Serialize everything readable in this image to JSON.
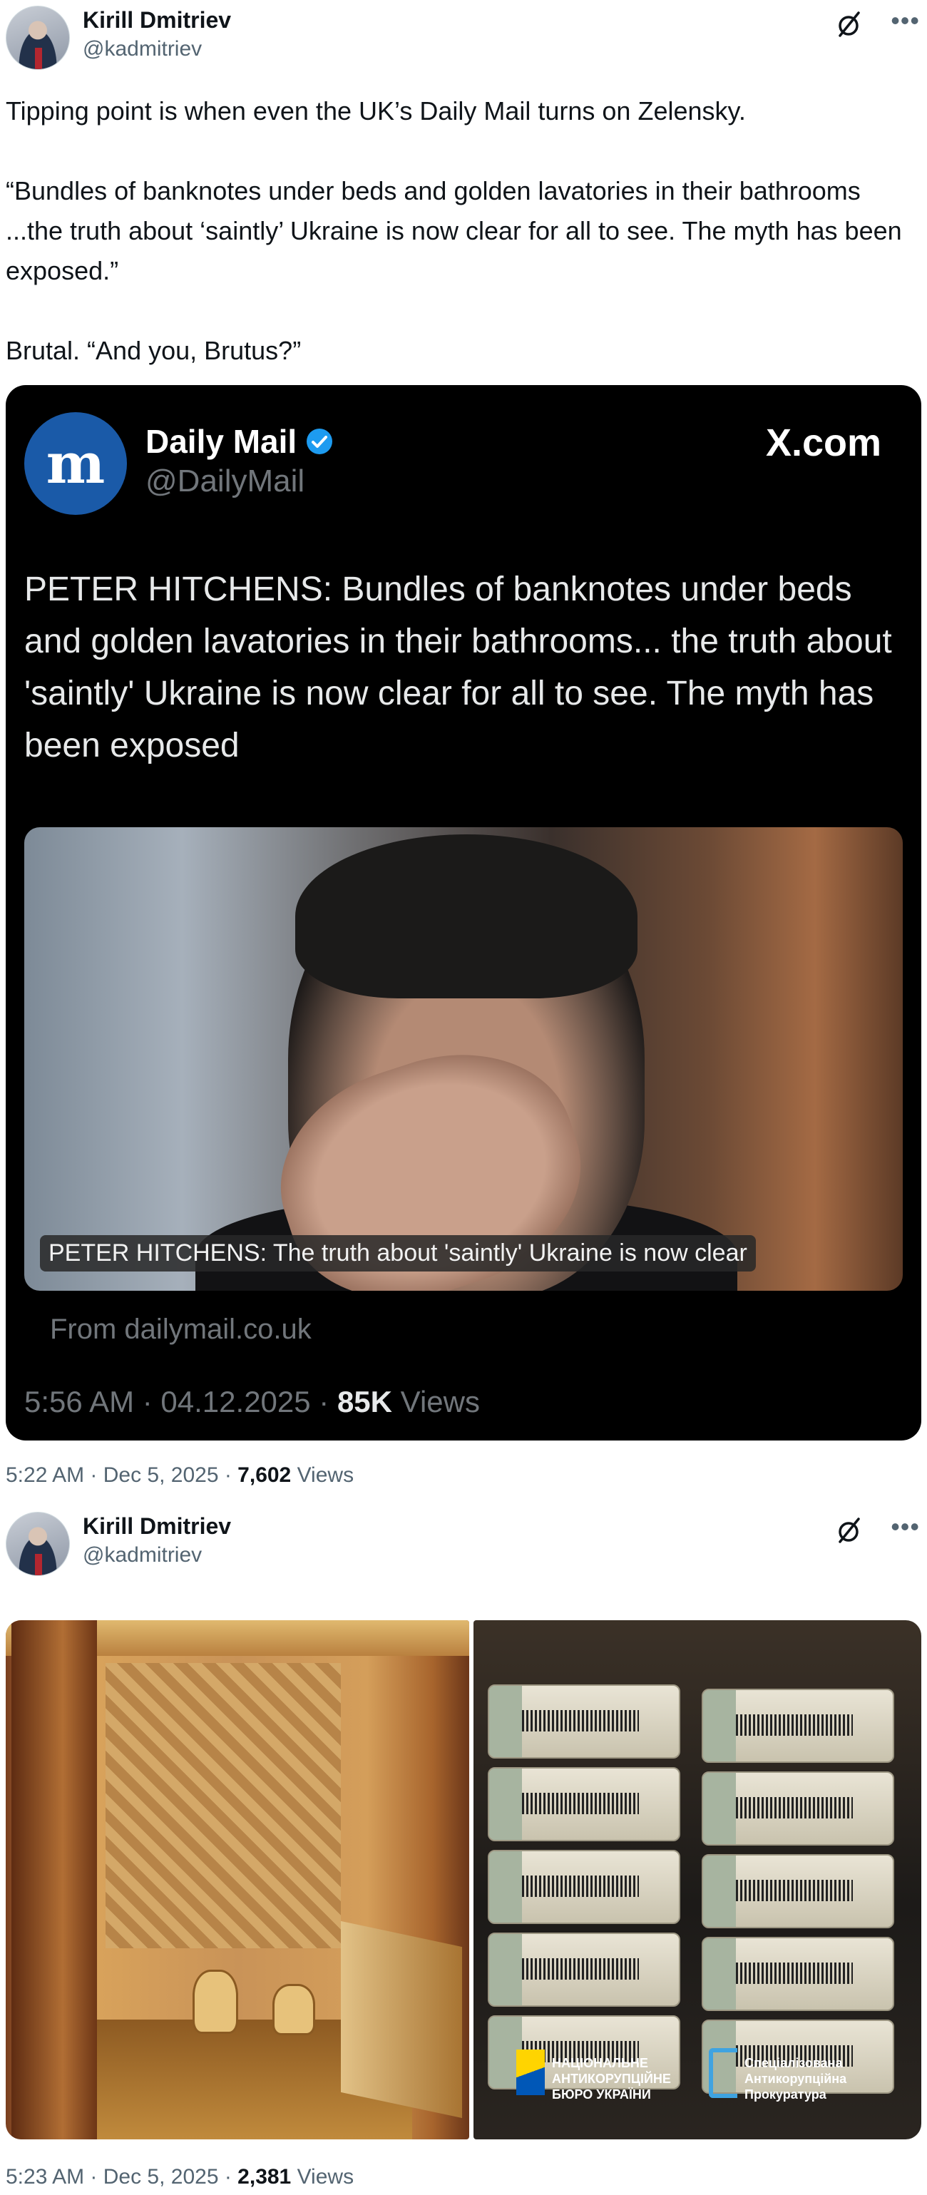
{
  "tweets": [
    {
      "author_name": "Kirill Dmitriev",
      "author_handle": "@kadmitriev",
      "text_paragraphs": [
        "Tipping point is when even the UK’s Daily Mail turns on Zelensky.",
        "“Bundles of banknotes under beds and golden lavatories in their bathrooms ...the truth about ‘saintly’ Ukraine is now clear for all to see. The myth has been exposed.”",
        "Brutal. “And you, Brutus?”"
      ],
      "quoted": {
        "logo_letter": "m",
        "name": "Daily Mail",
        "handle": "@DailyMail",
        "site": "X.com",
        "text": "PETER HITCHENS: Bundles of banknotes under beds and golden lavatories in their bathrooms... the truth about 'saintly' Ukraine is now clear for all to see. The myth has been exposed",
        "image_caption": "PETER HITCHENS: The truth about 'saintly' Ukraine is now clear",
        "source": "From dailymail.co.uk",
        "time": "5:56 AM · 04.12.2025 · ",
        "views_count": "85K",
        "views_label": " Views"
      },
      "time": "5:22 AM · Dec 5, 2025 · ",
      "views_count": "7,602",
      "views_label": " Views"
    },
    {
      "author_name": "Kirill Dmitriev",
      "author_handle": "@kadmitriev",
      "media_overlay": {
        "nabu_text": "НАЦІОНАЛЬНЕ АНТИКОРУПЦІЙНЕ БЮРО УКРАЇНИ",
        "sap_text": "Спеціалізована Антикорупційна Прокуратура"
      },
      "time": "5:23 AM · Dec 5, 2025 · ",
      "views_count": "2,381",
      "views_label": " Views"
    }
  ],
  "colors": {
    "text": "#0f1419",
    "secondary": "#536471",
    "verified": "#1d9bf0",
    "daily_mail_blue": "#1a5aa8"
  }
}
